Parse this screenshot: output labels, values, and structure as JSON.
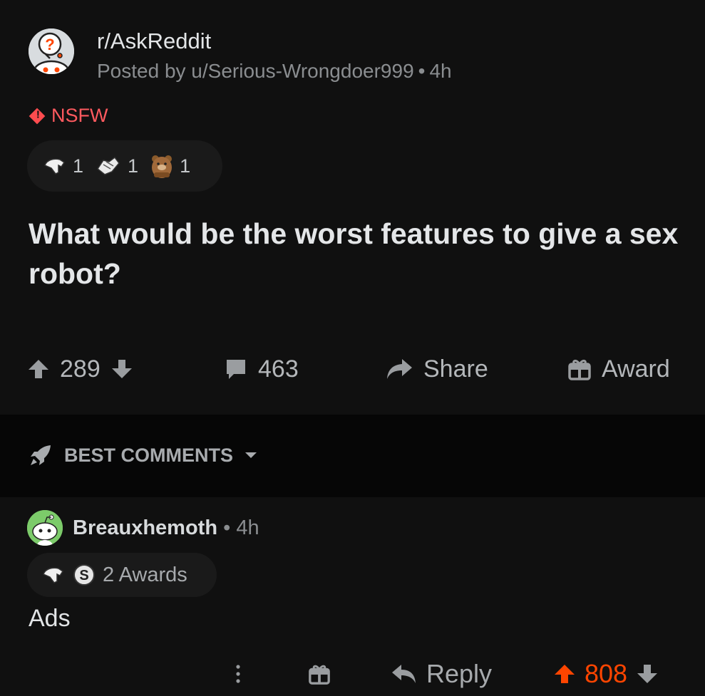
{
  "post": {
    "subreddit": "r/AskReddit",
    "posted_by": "Posted by u/Serious-Wrongdoer999",
    "separator": "•",
    "age": "4h",
    "nsfw_label": "NSFW",
    "awards": [
      {
        "icon": "hand-award-icon",
        "count": "1"
      },
      {
        "icon": "handshake-award-icon",
        "count": "1"
      },
      {
        "icon": "bear-award-icon",
        "count": "1"
      }
    ],
    "title": "What would be the worst features to give a sex robot?",
    "upvotes": "289",
    "comments": "463",
    "share_label": "Share",
    "award_label": "Award"
  },
  "comments_header": {
    "sort_label": "BEST COMMENTS"
  },
  "comment": {
    "username": "Breauxhemoth",
    "separator": "•",
    "age": "4h",
    "awards_label": "2 Awards",
    "body": "Ads",
    "reply_label": "Reply",
    "score": "808"
  },
  "colors": {
    "background": "#0b0b0b",
    "card": "#101010",
    "nsfw": "#ff4c4f",
    "upvote_active": "#ff4500",
    "muted": "#9a9da0"
  }
}
